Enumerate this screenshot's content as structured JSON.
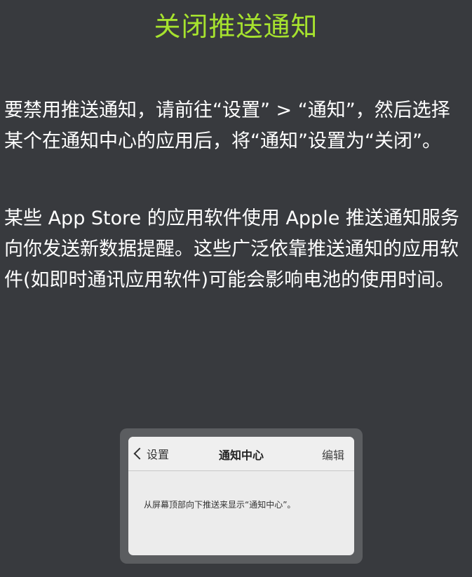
{
  "title": "关闭推送通知",
  "paragraphs": [
    "要禁用推送通知，请前往“设置” > “通知”，然后选择某个在通知中心的应用后，将“通知”设置为“关闭”。",
    "某些 App Store 的应用软件使用 Apple 推送通知服务向你发送新数据提醒。这些广泛依靠推送通知的应用软件(如即时通讯应用软件)可能会影响电池的使用时间。"
  ],
  "illustration": {
    "nav": {
      "back_label": "设置",
      "title": "通知中心",
      "edit_label": "编辑"
    },
    "hint": "从屏幕顶部向下推送来显示“通知中心”。"
  },
  "colors": {
    "background": "#383a3e",
    "title": "#a6e22e",
    "body_text": "#ffffff"
  },
  "icons": {
    "back": "chevron-left-icon"
  }
}
